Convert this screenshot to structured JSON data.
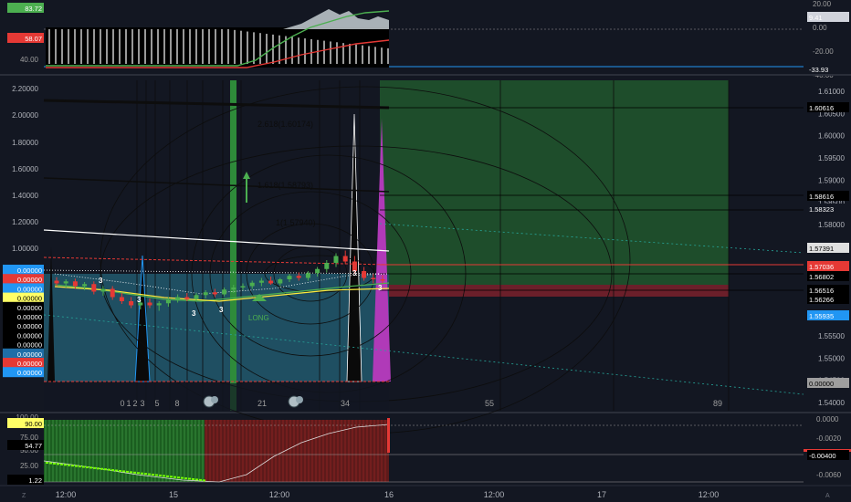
{
  "chart_data": {
    "type": "candlestick",
    "top_left_scale": [
      "40.00"
    ],
    "top_left_badges": [
      {
        "text": "83.72",
        "color": "#4caf50"
      },
      {
        "text": "58.07",
        "color": "#e53935"
      }
    ],
    "top_right_scale": [
      "20.00",
      "0.00",
      "-20.00",
      "-40.00"
    ],
    "top_right_badges": [
      {
        "text": "9.41",
        "color": "#d1d4dc"
      },
      {
        "text": "-33.93",
        "color": "#131722",
        "text_color": "#ffffff"
      }
    ],
    "left_price_ticks": [
      "2.20000",
      "2.00000",
      "1.80000",
      "1.60000",
      "1.40000",
      "1.20000",
      "1.00000"
    ],
    "left_badges": [
      {
        "text": "0.00000",
        "color": "#2196f3"
      },
      {
        "text": "0.00000",
        "color": "#e53935"
      },
      {
        "text": "0.00000",
        "color": "#2196f3"
      },
      {
        "text": "0.00000",
        "color": "#ffff66",
        "text_color": "#000000"
      },
      {
        "text": "0.00000",
        "color": "#000000"
      },
      {
        "text": "0.00000",
        "color": "#000000"
      },
      {
        "text": "0.00000",
        "color": "#000000"
      },
      {
        "text": "0.00000",
        "color": "#000000"
      },
      {
        "text": "0.00000",
        "color": "#000000"
      },
      {
        "text": "0.00000",
        "color": "#1e6ea7"
      },
      {
        "text": "0.00000",
        "color": "#e53935"
      },
      {
        "text": "0.00000",
        "color": "#2196f3"
      }
    ],
    "right_price_ticks": [
      "1.61000",
      "1.60500",
      "1.60000",
      "1.59500",
      "1.59000",
      "1.58500",
      "1.58000",
      "1.57500",
      "1.57000",
      "1.56500",
      "1.56000",
      "1.55500",
      "1.55000",
      "1.54500",
      "1.54000"
    ],
    "right_badges": [
      {
        "text": "1.60616",
        "color": "#000000"
      },
      {
        "text": "1.58616",
        "color": "#000000"
      },
      {
        "text": "1.58323",
        "color": "#131722"
      },
      {
        "text": "1.57391",
        "color": "#e0e0e0",
        "text_color": "#000000"
      },
      {
        "text": "1.57036",
        "color": "#e53935"
      },
      {
        "text": "1.56802",
        "color": "#000000"
      },
      {
        "text": "1.56516",
        "color": "#000000"
      },
      {
        "text": "1.56266",
        "color": "#000000"
      },
      {
        "text": "1.55935",
        "color": "#2196f3"
      },
      {
        "text": "0.00000",
        "color": "#9e9e9e",
        "text_color": "#000000"
      }
    ],
    "fib_labels": [
      "2.618(1.60174)",
      "1.618(1.58793)",
      "1(1.57940)"
    ],
    "long_label": "LONG",
    "count_labels": [
      "0",
      "1",
      "2",
      "3",
      "5",
      "8",
      "21",
      "34",
      "55",
      "89"
    ],
    "bar_labels": [
      "3",
      "3",
      "3",
      "3",
      "3",
      "3"
    ],
    "bottom_left_scale": [
      "100.00",
      "75.00",
      "50.00",
      "25.00"
    ],
    "bottom_left_badges": [
      {
        "text": "90.00",
        "color": "#ffff66",
        "text_color": "#000000"
      },
      {
        "text": "54.77",
        "color": "#000000"
      },
      {
        "text": "1.22",
        "color": "#000000"
      }
    ],
    "bottom_right_scale": [
      "0.0000",
      "-0.0020",
      "-0.0040",
      "-0.0060"
    ],
    "bottom_right_badges": [
      {
        "text": "-0.00400",
        "color": "#000000"
      }
    ],
    "x_ticks": [
      "12:00",
      "15",
      "12:00",
      "16",
      "12:00",
      "17",
      "12:00"
    ],
    "candles": [
      {
        "o": 1.566,
        "h": 1.5665,
        "l": 1.5652,
        "c": 1.5656
      },
      {
        "o": 1.5656,
        "h": 1.5662,
        "l": 1.565,
        "c": 1.5659
      },
      {
        "o": 1.5659,
        "h": 1.5663,
        "l": 1.5648,
        "c": 1.5652
      },
      {
        "o": 1.5652,
        "h": 1.5658,
        "l": 1.5646,
        "c": 1.5655
      },
      {
        "o": 1.5655,
        "h": 1.5659,
        "l": 1.564,
        "c": 1.5644
      },
      {
        "o": 1.5644,
        "h": 1.5652,
        "l": 1.5638,
        "c": 1.5648
      },
      {
        "o": 1.5648,
        "h": 1.5652,
        "l": 1.5632,
        "c": 1.5636
      },
      {
        "o": 1.5636,
        "h": 1.5642,
        "l": 1.5626,
        "c": 1.563
      },
      {
        "o": 1.563,
        "h": 1.5636,
        "l": 1.562,
        "c": 1.5624
      },
      {
        "o": 1.5624,
        "h": 1.5632,
        "l": 1.5618,
        "c": 1.5628
      },
      {
        "o": 1.5628,
        "h": 1.5634,
        "l": 1.562,
        "c": 1.5624
      },
      {
        "o": 1.5624,
        "h": 1.563,
        "l": 1.5616,
        "c": 1.5627
      },
      {
        "o": 1.5627,
        "h": 1.5636,
        "l": 1.5622,
        "c": 1.5632
      },
      {
        "o": 1.5632,
        "h": 1.564,
        "l": 1.5628,
        "c": 1.5636
      },
      {
        "o": 1.5636,
        "h": 1.5642,
        "l": 1.563,
        "c": 1.5633
      },
      {
        "o": 1.5633,
        "h": 1.5642,
        "l": 1.5629,
        "c": 1.5639
      },
      {
        "o": 1.5639,
        "h": 1.5646,
        "l": 1.5634,
        "c": 1.5643
      },
      {
        "o": 1.5643,
        "h": 1.5648,
        "l": 1.5636,
        "c": 1.564
      },
      {
        "o": 1.564,
        "h": 1.565,
        "l": 1.5637,
        "c": 1.5647
      },
      {
        "o": 1.5647,
        "h": 1.5654,
        "l": 1.5642,
        "c": 1.565
      },
      {
        "o": 1.565,
        "h": 1.5656,
        "l": 1.5646,
        "c": 1.5652
      },
      {
        "o": 1.5652,
        "h": 1.566,
        "l": 1.5648,
        "c": 1.5657
      },
      {
        "o": 1.5657,
        "h": 1.5664,
        "l": 1.5652,
        "c": 1.566
      },
      {
        "o": 1.566,
        "h": 1.5666,
        "l": 1.5654,
        "c": 1.5656
      },
      {
        "o": 1.5656,
        "h": 1.5664,
        "l": 1.5652,
        "c": 1.5662
      },
      {
        "o": 1.5662,
        "h": 1.567,
        "l": 1.5658,
        "c": 1.5667
      },
      {
        "o": 1.5667,
        "h": 1.5672,
        "l": 1.566,
        "c": 1.5664
      },
      {
        "o": 1.5664,
        "h": 1.5674,
        "l": 1.566,
        "c": 1.5671
      },
      {
        "o": 1.5671,
        "h": 1.568,
        "l": 1.5666,
        "c": 1.5677
      },
      {
        "o": 1.5677,
        "h": 1.569,
        "l": 1.5672,
        "c": 1.5686
      },
      {
        "o": 1.5686,
        "h": 1.57,
        "l": 1.568,
        "c": 1.5696
      },
      {
        "o": 1.5696,
        "h": 1.5704,
        "l": 1.5684,
        "c": 1.5688
      },
      {
        "o": 1.5688,
        "h": 1.5696,
        "l": 1.567,
        "c": 1.5674
      },
      {
        "o": 1.5674,
        "h": 1.568,
        "l": 1.566,
        "c": 1.5664
      },
      {
        "o": 1.5664,
        "h": 1.567,
        "l": 1.5656,
        "c": 1.5662
      },
      {
        "o": 1.5662,
        "h": 1.5668,
        "l": 1.5656,
        "c": 1.566
      }
    ]
  }
}
